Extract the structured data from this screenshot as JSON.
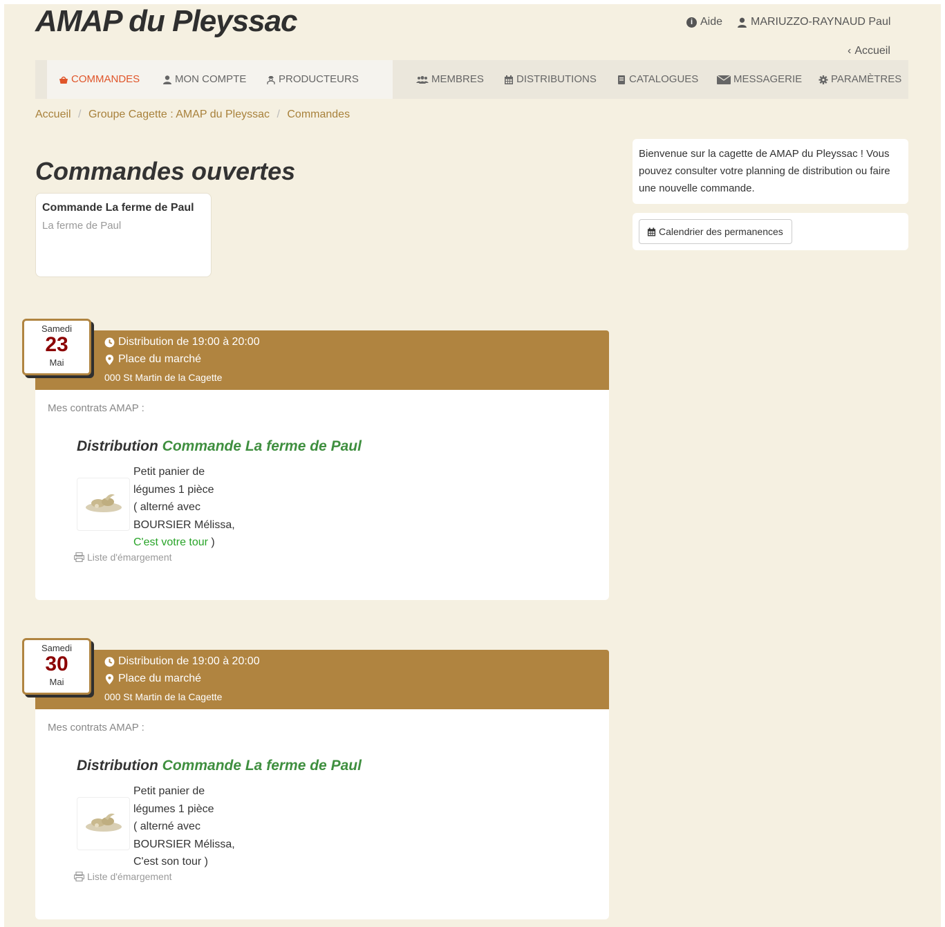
{
  "site": {
    "title": "AMAP du Pleyssac"
  },
  "top_links": {
    "help": "Aide",
    "user": "MARIUZZO-RAYNAUD Paul",
    "home": "Accueil"
  },
  "nav": {
    "left": [
      {
        "label": "COMMANDES",
        "icon": "basket-icon",
        "active": true
      },
      {
        "label": "MON COMPTE",
        "icon": "user-icon"
      },
      {
        "label": "PRODUCTEURS",
        "icon": "farmer-icon"
      }
    ],
    "right": [
      {
        "label": "MEMBRES",
        "icon": "users-icon"
      },
      {
        "label": "DISTRIBUTIONS",
        "icon": "calendar-icon"
      },
      {
        "label": "CATALOGUES",
        "icon": "book-icon"
      },
      {
        "label": "MESSAGERIE",
        "icon": "envelope-icon"
      },
      {
        "label": "PARAMÈTRES",
        "icon": "gear-icon"
      }
    ]
  },
  "breadcrumb": [
    "Accueil",
    "Groupe Cagette : AMAP du Pleyssac",
    "Commandes"
  ],
  "main": {
    "heading": "Commandes ouvertes",
    "open_orders": [
      {
        "title": "Commande La ferme de Paul",
        "producer": "La ferme de Paul"
      }
    ]
  },
  "sidebar": {
    "welcome": "Bienvenue sur la cagette de AMAP du Pleyssac ! Vous pouvez consulter votre planning de distribution ou faire une nouvelle commande.",
    "calendar_button": "Calendrier des permanences"
  },
  "distributions": [
    {
      "day_of_week": "Samedi",
      "day": "23",
      "month": "Mai",
      "time": "Distribution de 19:00 à 20:00",
      "place": "Place du marché",
      "address": "000 St Martin de la Cagette",
      "contracts_label": "Mes contrats AMAP :",
      "title_prefix": "Distribution",
      "title_name": "Commande La ferme de Paul",
      "product_lines": [
        "Petit panier de",
        "légumes 1 pièce",
        "( alterné avec",
        "BOURSIER Mélissa,"
      ],
      "turn": "C'est votre tour",
      "turn_close": " )",
      "is_my_turn": true,
      "sheet_link": "Liste d'émargement"
    },
    {
      "day_of_week": "Samedi",
      "day": "30",
      "month": "Mai",
      "time": "Distribution de 19:00 à 20:00",
      "place": "Place du marché",
      "address": "000 St Martin de la Cagette",
      "contracts_label": "Mes contrats AMAP :",
      "title_prefix": "Distribution",
      "title_name": "Commande La ferme de Paul",
      "product_lines": [
        "Petit panier de",
        "légumes 1 pièce",
        "( alterné avec",
        "BOURSIER Mélissa,"
      ],
      "turn": "C'est son tour",
      "turn_close": " )",
      "is_my_turn": false,
      "sheet_link": "Liste d'émargement"
    }
  ],
  "colors": {
    "header_brown": "#b08440",
    "active_orange": "#e0552a",
    "link_gold": "#a8813b",
    "turn_green": "#28a428",
    "date_red": "#8b0000"
  }
}
